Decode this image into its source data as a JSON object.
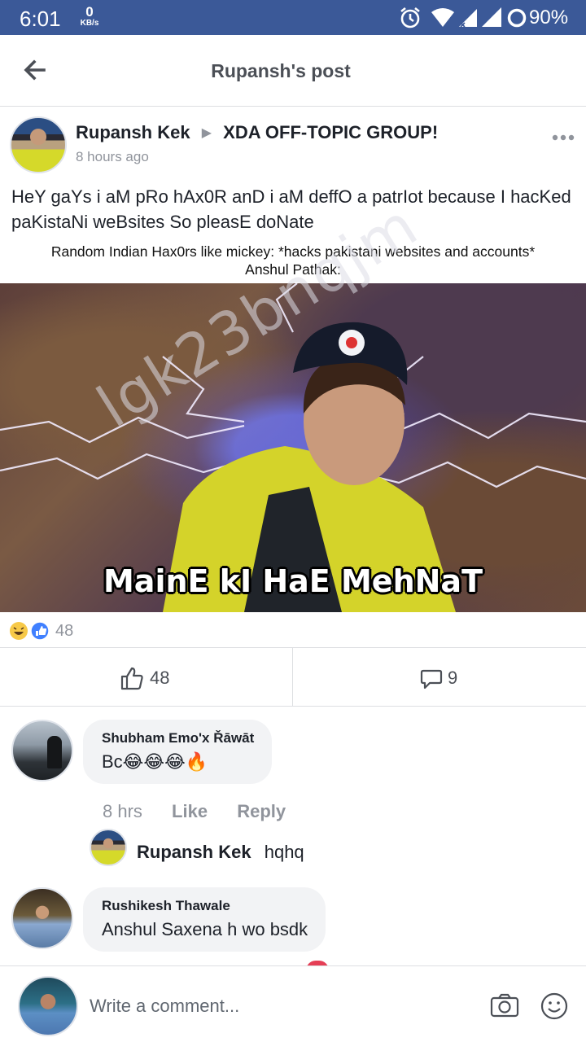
{
  "status_bar": {
    "time": "6:01",
    "net_speed_value": "0",
    "net_speed_unit": "KB/s",
    "battery": "90%",
    "background_color": "#3b5998"
  },
  "app_bar": {
    "title": "Rupansh's post",
    "back_icon": "arrow-left-icon"
  },
  "post": {
    "author": "Rupansh Kek",
    "group": "XDA OFF-TOPIC GROUP!",
    "time": "8 hours ago",
    "text": "HeY gaYs i aM pRo hAx0R anD i aM deffO a patrIot because I hacKed paKistaNi weBsites So pleasE doNate",
    "meme": {
      "caption_line1": "Random Indian Hax0rs like mickey: *hacks pakistani websites and accounts*",
      "caption_line2": "Anshul Pathak:",
      "watermark": "lgk23bnqjm",
      "image_text": "MainE kI HaE MehNaT"
    },
    "reaction_count": "48",
    "like_count": "48",
    "comment_count": "9"
  },
  "comments": [
    {
      "name": "Shubham Emo'x Řāwāt",
      "text": "Bc😂😂😂🔥",
      "time": "8 hrs",
      "like_label": "Like",
      "reply_label": "Reply",
      "reply": {
        "name": "Rupansh Kek",
        "text": "hqhq"
      }
    },
    {
      "name": "Rushikesh Thawale",
      "text": "Anshul Saxena h wo bsdk"
    }
  ],
  "composer": {
    "placeholder": "Write a comment..."
  },
  "colors": {
    "brand": "#3b5998",
    "like_blue": "#4080ff",
    "secondary_text": "#90949c",
    "divider": "#dddfe2",
    "bubble": "#f2f3f5"
  }
}
